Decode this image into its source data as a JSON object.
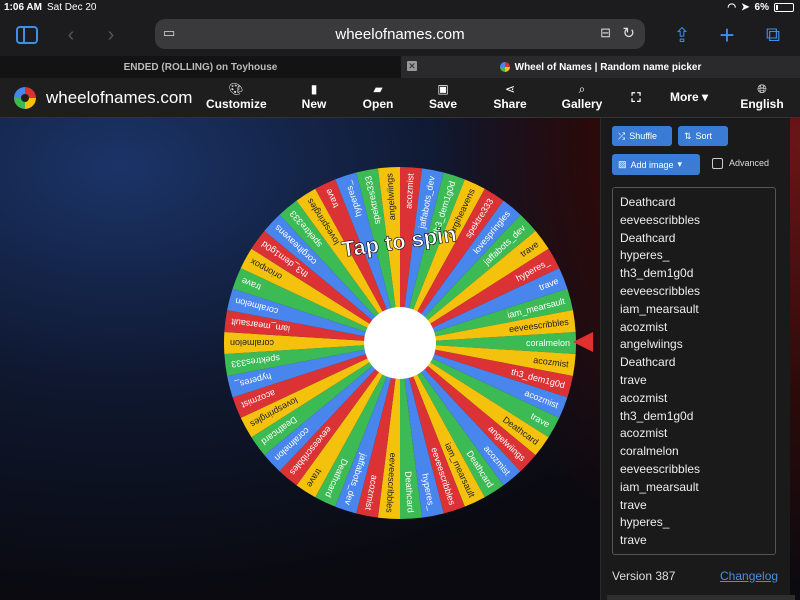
{
  "status": {
    "time": "1:06 AM",
    "date": "Sat Dec 20",
    "battery": "6%"
  },
  "browser": {
    "url": "wheelofnames.com",
    "tabs": [
      {
        "label": "ENDED (ROLLING) on Toyhouse",
        "active": false
      },
      {
        "label": "Wheel of Names | Random name picker",
        "active": true
      }
    ]
  },
  "app": {
    "name": "wheelofnames.com",
    "nav": [
      {
        "label": "Customize",
        "icon": "palette-icon"
      },
      {
        "label": "New",
        "icon": "file-icon"
      },
      {
        "label": "Open",
        "icon": "folder-open-icon"
      },
      {
        "label": "Save",
        "icon": "save-icon"
      },
      {
        "label": "Share",
        "icon": "share-icon"
      },
      {
        "label": "Gallery",
        "icon": "search-icon"
      },
      {
        "label": "",
        "icon": "fullscreen-icon"
      },
      {
        "label": "More",
        "icon": "chevron-down-icon"
      },
      {
        "label": "English",
        "icon": "globe-icon"
      }
    ]
  },
  "wheel": {
    "center_text": "Tap to spin",
    "colors": [
      "#3cba54",
      "#f4c20d",
      "#db3236",
      "#4885ed"
    ],
    "segments": [
      "coralmelon",
      "acozmist",
      "th3_dem1g0d",
      "acozmist",
      "trave",
      "Deathcard",
      "angelwiings",
      "acozmist",
      "Deathcard",
      "iam_mearsault",
      "eeveescribbles",
      "hyperes_",
      "Deathcard",
      "eeveescribbles",
      "acozmist",
      "jaffabots_dev",
      "Deathcard",
      "trave",
      "eeveescribbles",
      "coralmelon",
      "Deathcard",
      "lovespringles",
      "acozmist",
      "hyperes_",
      "spektres333",
      "coralmelon",
      "iam_mearsault",
      "coralmelon",
      "trave",
      "orionpox",
      "th3_dem1g0d",
      "corgiheavens",
      "spektre333",
      "lovespringles",
      "trave",
      "hyperes_",
      "spektres333",
      "angelwiings",
      "acozmist",
      "jaffabots_dev",
      "th3_dem1g0d",
      "corgiheavens",
      "spektre333",
      "lovespringles",
      "jaffabots_dev",
      "trave",
      "hyperes_",
      "trave",
      "iam_mearsault",
      "eeveescribbles"
    ]
  },
  "sidebar": {
    "shuffle": "Shuffle",
    "sort": "Sort",
    "add_image": "Add image",
    "advanced": "Advanced",
    "entries": [
      "Deathcard",
      "eeveescribbles",
      "Deathcard",
      "hyperes_",
      "th3_dem1g0d",
      "eeveescribbles",
      "iam_mearsault",
      "acozmist",
      "angelwiings",
      "Deathcard",
      "trave",
      "acozmist",
      "th3_dem1g0d",
      "acozmist",
      "coralmelon",
      "eeveescribbles",
      "iam_mearsault",
      "trave",
      "hyperes_",
      "trave"
    ],
    "version": "Version 387",
    "changelog": "Changelog"
  }
}
